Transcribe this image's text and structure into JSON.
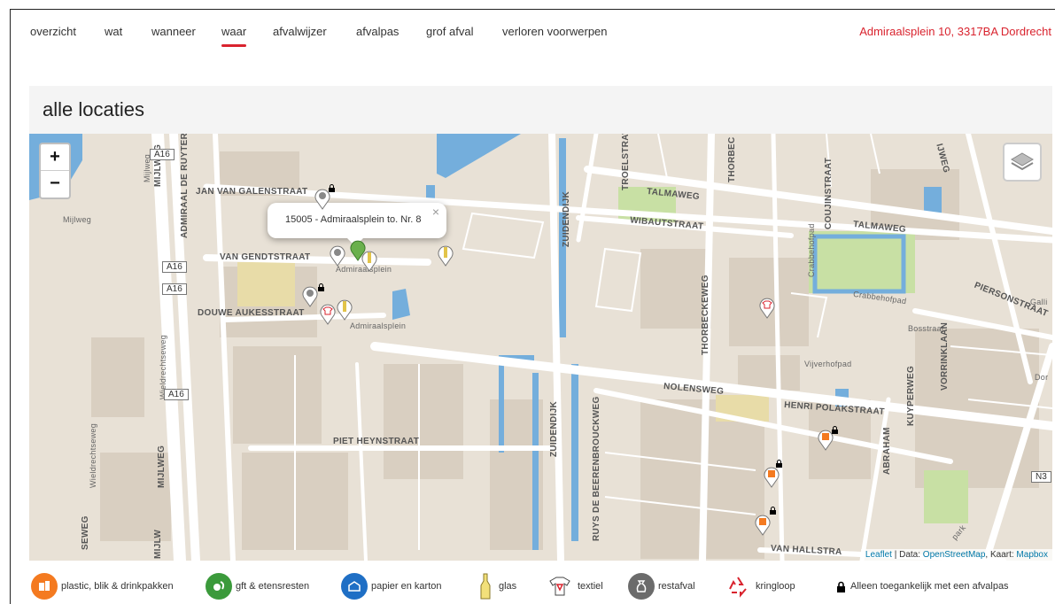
{
  "nav": {
    "items": [
      "overzicht",
      "wat",
      "wanneer",
      "waar",
      "afvalwijzer",
      "afvalpas",
      "grof afval",
      "verloren voorwerpen"
    ],
    "active": "waar",
    "address": "Admiraalsplein 10, 3317BA Dordrecht"
  },
  "page": {
    "title": "alle locaties"
  },
  "map": {
    "zoom_in": "+",
    "zoom_out": "−",
    "popup": {
      "text": "15005 - Admiraalsplein to. Nr. 8",
      "close": "×"
    },
    "streets": {
      "jan_van_galenstraat": "JAN VAN GALENSTRAAT",
      "admiraal_de_ruyter": "ADMIRAAL DE RUYTER",
      "van_gendtstraat": "VAN GENDTSTRAAT",
      "douwe_aukesstraat": "DOUWE AUKESSTRAAT",
      "admiraalsplein": "Admiraalsplein",
      "admiraalsplein_2": "Admiraalsplein",
      "piet_heynstraat": "PIET HEYNSTRAAT",
      "mijlweg": "MIJLWEG",
      "mijlweg_2": "MIJLWEG",
      "mijlweg_small": "Mijlweg",
      "mijlweg_small_2": "Mijlweg",
      "mijlweg_bottom": "MIJLW",
      "seweg": "SEWEG",
      "wieldrechtseweg": "Wieldrechtseweg",
      "wieldrechtseweg_2": "Wieldrechtseweg",
      "zuidendijk": "ZUIDENDIJK",
      "zuidendijk_2": "ZUIDENDIJK",
      "troelstraweg": "TROELSTRAW",
      "thorbeckeweg": "THORBECKEWEG",
      "thorbec": "THORBEC",
      "talmaweg": "TALMAWEG",
      "talmaweg_2": "TALMAWEG",
      "wibautstraat": "WIBAUTSTRAAT",
      "coujinstraat": "COUJINSTRAAT",
      "crabbehofpad": "Crabbehofpad",
      "crabbehofpad_2": "Crabbehofpad",
      "piersonstraat": "PIERSONSTRAAT",
      "bosstraat": "Bosstraat",
      "vijverhofpad": "Vijverhofpad",
      "nolensweg": "NOLENSWEG",
      "henri_polakstraat": "HENRI POLAKSTRAAT",
      "kuyperweg": "KUYPERWEG",
      "abraham": "ABRAHAM",
      "vorrinklaan": "VORRINKLAAN",
      "ruys": "RUYS DE BEERENBROUCKWEG",
      "van_hall": "VAN HALLSTRA",
      "dor": "Dor",
      "galli": "Galli",
      "ijweg": "IJWEG",
      "park": "park"
    },
    "shields": [
      "A16",
      "A16",
      "A16",
      "A16",
      "N3"
    ],
    "attribution": {
      "leaflet": "Leaflet",
      "sep1": " | Data: ",
      "osm": "OpenStreetMap",
      "sep2": ", Kaart: ",
      "mapbox": "Mapbox"
    }
  },
  "legend": [
    {
      "label": "plastic, blik & drinkpakken",
      "icon": "pmd-icon",
      "color": "#f47a20"
    },
    {
      "label": "gft & etensresten",
      "icon": "gft-icon",
      "color": "#3b9a3b"
    },
    {
      "label": "papier en karton",
      "icon": "paper-icon",
      "color": "#1f6fc5"
    },
    {
      "label": "glas",
      "icon": "glass-icon",
      "color": "#f2c400"
    },
    {
      "label": "textiel",
      "icon": "textile-icon",
      "color": "#d9232e"
    },
    {
      "label": "restafval",
      "icon": "restafval-icon",
      "color": "#6b6b6b"
    },
    {
      "label": "kringloop",
      "icon": "kringloop-icon",
      "color": "#d9232e"
    },
    {
      "label": "Alleen toegankelijk met een afvalpas",
      "icon": "lock-icon",
      "color": "#000000"
    }
  ],
  "colors": {
    "accent": "#d9232e",
    "water": "#74aedc",
    "park": "#c8e0a4"
  }
}
